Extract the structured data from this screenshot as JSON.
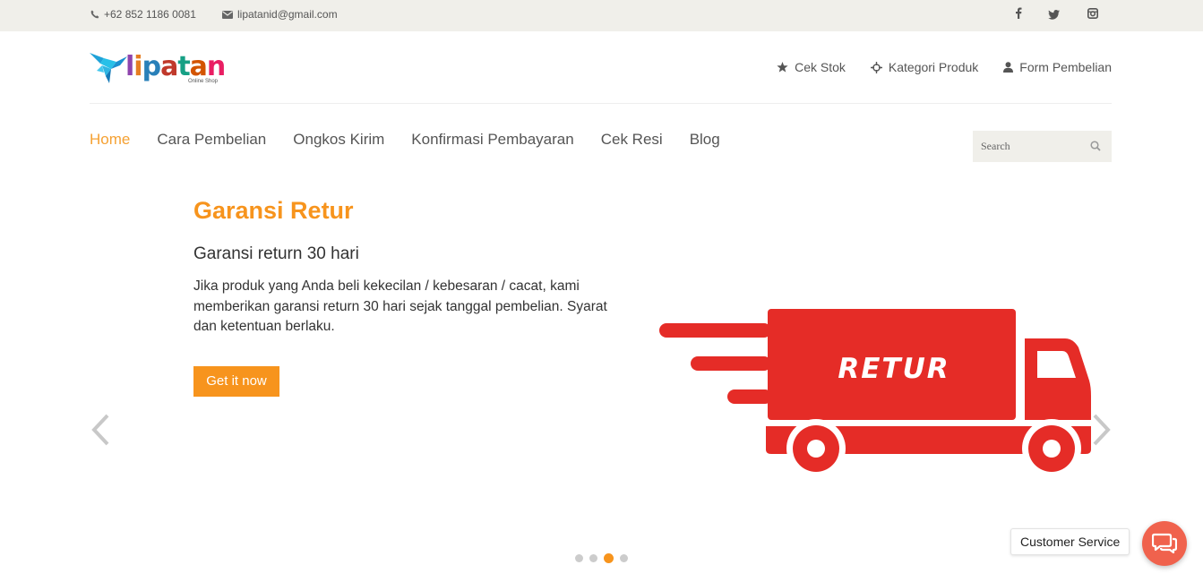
{
  "topbar": {
    "phone": "+62 852 1186 0081",
    "email": "lipatanid@gmail.com",
    "social": [
      {
        "icon": "facebook-icon",
        "glyph": "f"
      },
      {
        "icon": "twitter-icon",
        "glyph": "t"
      },
      {
        "icon": "instagram-icon",
        "glyph": "ig"
      }
    ]
  },
  "logo": {
    "text": "lipatan",
    "subtitle": "Online Shop"
  },
  "header_links": [
    {
      "label": "Cek Stok",
      "icon": "star-icon"
    },
    {
      "label": "Kategori Produk",
      "icon": "crosshair-icon"
    },
    {
      "label": "Form Pembelian",
      "icon": "user-icon"
    }
  ],
  "nav": {
    "items": [
      "Home",
      "Cara Pembelian",
      "Ongkos Kirim",
      "Konfirmasi Pembayaran",
      "Cek Resi",
      "Blog"
    ],
    "active": "Home"
  },
  "search": {
    "placeholder": "Search"
  },
  "slide": {
    "title": "Garansi Retur",
    "subtitle": "Garansi return 30 hari",
    "description": "Jika produk yang Anda beli kekecilan / kebesaran / cacat, kami memberikan garansi return 30 hari sejak tanggal pembelian. Syarat dan ketentuan berlaku.",
    "cta": "Get it now",
    "image_text": "RETUR",
    "slide_count": 4,
    "active_index": 3
  },
  "chat": {
    "label": "Customer Service"
  },
  "colors": {
    "accent": "#f7941d",
    "topbar_bg": "#f0efea",
    "truck_red": "#e52c27",
    "chat_red": "#f0624d"
  }
}
